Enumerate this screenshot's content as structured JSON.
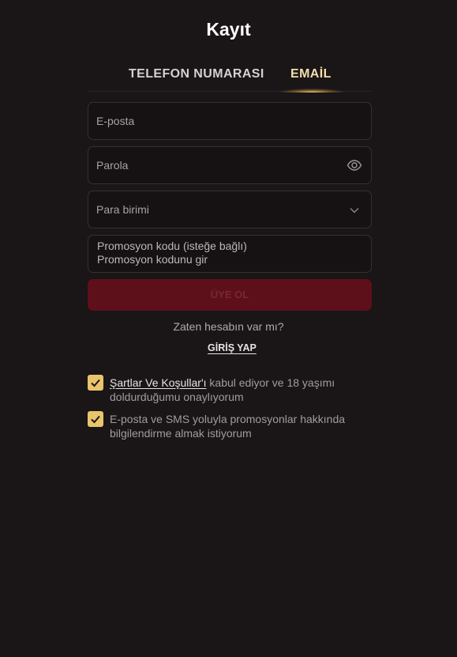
{
  "header": {
    "title": "Kayıt"
  },
  "tabs": [
    {
      "label": "TELEFON NUMARASI",
      "active": false
    },
    {
      "label": "EMAİL",
      "active": true
    }
  ],
  "form": {
    "email": {
      "placeholder": "E-posta",
      "value": ""
    },
    "password": {
      "placeholder": "Parola",
      "value": "",
      "icon": "eye-icon"
    },
    "currency": {
      "placeholder": "Para birimi",
      "icon": "chevron-down-icon"
    },
    "promo": {
      "label": "Promosyon kodu (isteğe bağlı)",
      "placeholder": "Promosyon kodunu gir"
    },
    "submit_label": "ÜYE OL"
  },
  "login": {
    "question": "Zaten hesabın var mı?",
    "link_label": "GİRİŞ YAP"
  },
  "consents": [
    {
      "checked": true,
      "link_text": "Şartlar Ve Koşullar'ı",
      "text": " kabul ediyor ve 18 yaşımı doldurduğumu onaylıyorum"
    },
    {
      "checked": true,
      "text": "E-posta ve SMS yoluyla promosyonlar hakkında bilgilendirme almak istiyorum"
    }
  ],
  "colors": {
    "background": "#1a1517",
    "accent_gold": "#e9c46c",
    "submit_bg": "#5d1019"
  }
}
